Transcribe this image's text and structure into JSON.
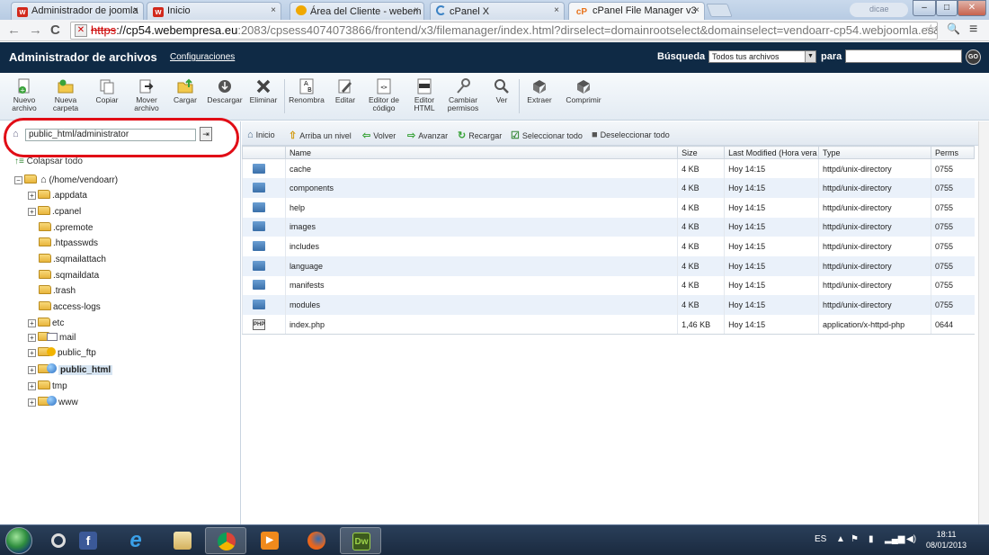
{
  "browser": {
    "tabs": [
      {
        "label": "Administrador de joomla",
        "icon": "joomla-icon",
        "close": "×"
      },
      {
        "label": "Inicio",
        "icon": "joomla-icon",
        "close": "×"
      },
      {
        "label": "Área del Cliente - webem",
        "icon": "webempresa-icon",
        "close": "×"
      },
      {
        "label": "cPanel X",
        "icon": "loading-icon",
        "close": "×"
      },
      {
        "label": "cPanel File Manager v3",
        "icon": "cpanel-icon",
        "close": "×"
      }
    ],
    "window_buttons": {
      "minimize": "–",
      "maximize": "□",
      "close": "✕"
    },
    "url_https": "https",
    "url_host": "://cp54.webempresa.eu",
    "url_rest": ":2083/cpsess4074073866/frontend/x3/filemanager/index.html?dirselect=domainrootselect&domainselect=vendoarr-cp54.webjoomla.es&dir=%2F",
    "tab_search_placeholder": "dicae",
    "nav": {
      "back": "←",
      "forward": "→",
      "reload": "C",
      "star": "☆",
      "search": "🔍",
      "menu": "≡"
    }
  },
  "header": {
    "title": "Administrador de archivos",
    "settings_link": "Configuraciones",
    "search_label": "Búsqueda",
    "search_scope": "Todos tus archivos",
    "for_label": "para",
    "search_value": "",
    "go_label": "GO"
  },
  "toolbar": {
    "items": [
      {
        "label": "Nuevo archivo",
        "icon": "new-file-icon"
      },
      {
        "label": "Nueva carpeta",
        "icon": "new-folder-icon"
      },
      {
        "label": "Copiar",
        "icon": "copy-icon"
      },
      {
        "label": "Mover archivo",
        "icon": "move-file-icon"
      },
      {
        "label": "Cargar",
        "icon": "upload-icon"
      },
      {
        "label": "Descargar",
        "icon": "download-icon"
      },
      {
        "label": "Eliminar",
        "icon": "delete-icon"
      },
      {
        "label": "Renombra",
        "icon": "rename-icon"
      },
      {
        "label": "Editar",
        "icon": "edit-icon"
      },
      {
        "label": "Editor de código",
        "icon": "code-editor-icon"
      },
      {
        "label": "Editor HTML",
        "icon": "html-editor-icon"
      },
      {
        "label": "Cambiar permisos",
        "icon": "permissions-icon"
      },
      {
        "label": "Ver",
        "icon": "view-icon"
      },
      {
        "label": "Extraer",
        "icon": "extract-icon"
      },
      {
        "label": "Comprimir",
        "icon": "compress-icon"
      }
    ]
  },
  "sidebar": {
    "path_value": "public_html/administrator",
    "collapse_label": "Colapsar todo",
    "root_label": "(/home/vendoarr)",
    "tree": [
      {
        "label": ".appdata",
        "expandable": true
      },
      {
        "label": ".cpanel",
        "expandable": true
      },
      {
        "label": ".cpremote",
        "expandable": false
      },
      {
        "label": ".htpasswds",
        "expandable": false
      },
      {
        "label": ".sqmailattach",
        "expandable": false
      },
      {
        "label": ".sqmaildata",
        "expandable": false
      },
      {
        "label": ".trash",
        "expandable": false
      },
      {
        "label": "access-logs",
        "expandable": false
      },
      {
        "label": "etc",
        "expandable": true
      },
      {
        "label": "mail",
        "expandable": true
      },
      {
        "label": "public_ftp",
        "expandable": true
      },
      {
        "label": "public_html",
        "expandable": true,
        "selected": true
      },
      {
        "label": "tmp",
        "expandable": true
      },
      {
        "label": "www",
        "expandable": true
      }
    ]
  },
  "filenav": {
    "home": "Inicio",
    "up": "Arriba un nivel",
    "back": "Volver",
    "forward": "Avanzar",
    "reload": "Recargar",
    "select_all": "Seleccionar todo",
    "deselect_all": "Deseleccionar todo"
  },
  "table": {
    "headers": [
      "Name",
      "Size",
      "Last Modified (Hora vera",
      "Type",
      "Perms"
    ],
    "rows": [
      {
        "name": "cache",
        "size": "4 KB",
        "modified": "Hoy 14:15",
        "type": "httpd/unix-directory",
        "perms": "0755",
        "kind": "folder"
      },
      {
        "name": "components",
        "size": "4 KB",
        "modified": "Hoy 14:15",
        "type": "httpd/unix-directory",
        "perms": "0755",
        "kind": "folder"
      },
      {
        "name": "help",
        "size": "4 KB",
        "modified": "Hoy 14:15",
        "type": "httpd/unix-directory",
        "perms": "0755",
        "kind": "folder"
      },
      {
        "name": "images",
        "size": "4 KB",
        "modified": "Hoy 14:15",
        "type": "httpd/unix-directory",
        "perms": "0755",
        "kind": "folder"
      },
      {
        "name": "includes",
        "size": "4 KB",
        "modified": "Hoy 14:15",
        "type": "httpd/unix-directory",
        "perms": "0755",
        "kind": "folder"
      },
      {
        "name": "language",
        "size": "4 KB",
        "modified": "Hoy 14:15",
        "type": "httpd/unix-directory",
        "perms": "0755",
        "kind": "folder"
      },
      {
        "name": "manifests",
        "size": "4 KB",
        "modified": "Hoy 14:15",
        "type": "httpd/unix-directory",
        "perms": "0755",
        "kind": "folder"
      },
      {
        "name": "modules",
        "size": "4 KB",
        "modified": "Hoy 14:15",
        "type": "httpd/unix-directory",
        "perms": "0755",
        "kind": "folder"
      },
      {
        "name": "index.php",
        "size": "1,46 KB",
        "modified": "Hoy 14:15",
        "type": "application/x-httpd-php",
        "perms": "0644",
        "kind": "php"
      }
    ]
  },
  "taskbar": {
    "apps": [
      "chrome-like-icon",
      "facebook-icon",
      "ie-icon",
      "explorer-icon",
      "chrome-icon",
      "media-player-icon",
      "firefox-icon",
      "dreamweaver-icon"
    ],
    "facebook_glyph": "f",
    "ie_glyph": "e",
    "dw_glyph": "Dw",
    "lang": "ES",
    "time": "18:11",
    "date": "08/01/2013"
  },
  "colors": {
    "header_bg": "#0f2a45",
    "highlight": "#e10d16",
    "row_alt": "#eaf1fa"
  }
}
